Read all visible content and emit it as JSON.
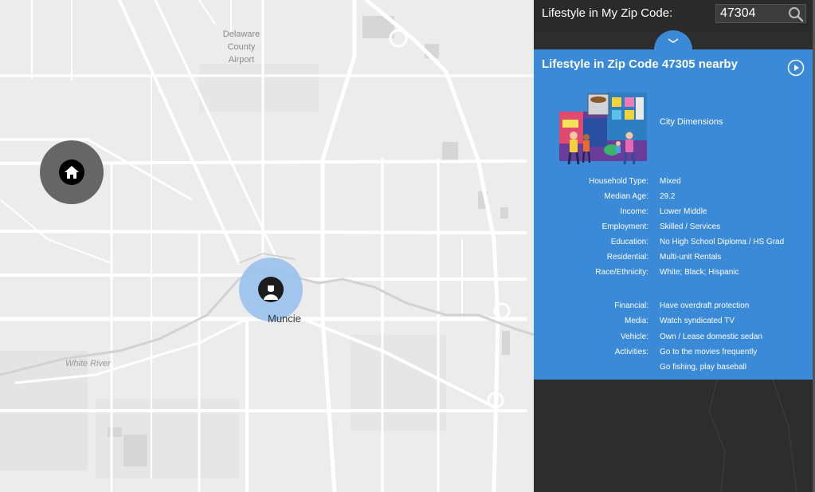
{
  "map": {
    "airport_label": "Delaware\nCounty\nAirport",
    "river_label": "White River",
    "city_label": "Muncie",
    "markers": [
      {
        "name": "home",
        "icon": "home-icon"
      },
      {
        "name": "zip",
        "icon": "person-icon"
      }
    ]
  },
  "panel": {
    "header_title": "Lifestyle in My Zip Code:",
    "search_value": "47304",
    "card_title": "Lifestyle in Zip Code 47305 nearby",
    "segment_name": "City Dimensions",
    "attributes": [
      {
        "label": "Household Type:",
        "value": "Mixed"
      },
      {
        "label": "Median Age:",
        "value": "29.2"
      },
      {
        "label": "Income:",
        "value": "Lower Middle"
      },
      {
        "label": "Employment:",
        "value": "Skilled / Services"
      },
      {
        "label": "Education:",
        "value": "No High School Diploma / HS Grad"
      },
      {
        "label": "Residential:",
        "value": "Multi-unit Rentals"
      },
      {
        "label": "Race/Ethnicity:",
        "value": "White; Black; Hispanic"
      }
    ],
    "behaviors": [
      {
        "label": "Financial:",
        "value": "Have overdraft protection"
      },
      {
        "label": "Media:",
        "value": "Watch syndicated TV"
      },
      {
        "label": "Vehicle:",
        "value": "Own / Lease domestic sedan"
      },
      {
        "label": "Activities:",
        "value": "Go to the movies frequently"
      },
      {
        "label": "",
        "value": "Go fishing, play baseball"
      }
    ]
  },
  "colors": {
    "card": "#3b8ad8",
    "panel": "#2d2d2d",
    "map_bg": "#ececec",
    "home_marker": "#666666",
    "zip_marker": "#9dc3ec"
  }
}
